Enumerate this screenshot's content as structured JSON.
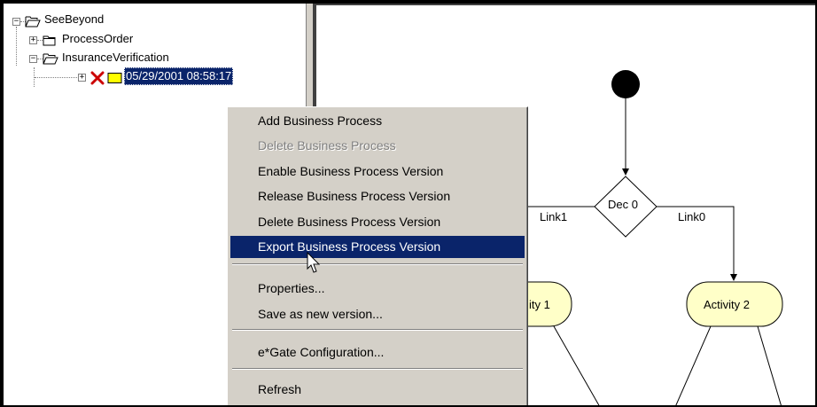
{
  "tree": {
    "root_label": "SeeBeyond",
    "child1_label": "ProcessOrder",
    "child2_label": "InsuranceVerification",
    "version_label": "05/29/2001 08:58:17"
  },
  "context_menu": {
    "items": [
      {
        "label": "Add Business Process",
        "enabled": true
      },
      {
        "label": "Delete Business Process",
        "enabled": false
      },
      {
        "label": "Enable Business Process Version",
        "enabled": true
      },
      {
        "label": "Release Business Process Version",
        "enabled": true
      },
      {
        "label": "Delete Business Process Version",
        "enabled": true
      },
      {
        "label": "Export Business Process Version",
        "enabled": true,
        "highlighted": true
      },
      {
        "label": "Properties...",
        "enabled": true
      },
      {
        "label": "Save as new version...",
        "enabled": true
      },
      {
        "label": "e*Gate Configuration...",
        "enabled": true
      },
      {
        "label": "Refresh",
        "enabled": true
      }
    ]
  },
  "diagram": {
    "decision_label": "Dec 0",
    "link1_label": "Link1",
    "link0_label": "Link0",
    "activity1_label": "ity 1",
    "activity2_label": "Activity 2"
  },
  "colors": {
    "selection": "#0a246a",
    "menu_bg": "#d4d0c8",
    "activity_fill": "#ffffc8",
    "delete_x": "#cc0000",
    "version_icon": "#ffff00"
  },
  "icons": {
    "folder": "open-folder-icon",
    "closed_folder": "closed-folder-icon",
    "delete_mark": "red-x-icon",
    "version": "yellow-box-icon",
    "cursor": "arrow-cursor-icon"
  }
}
